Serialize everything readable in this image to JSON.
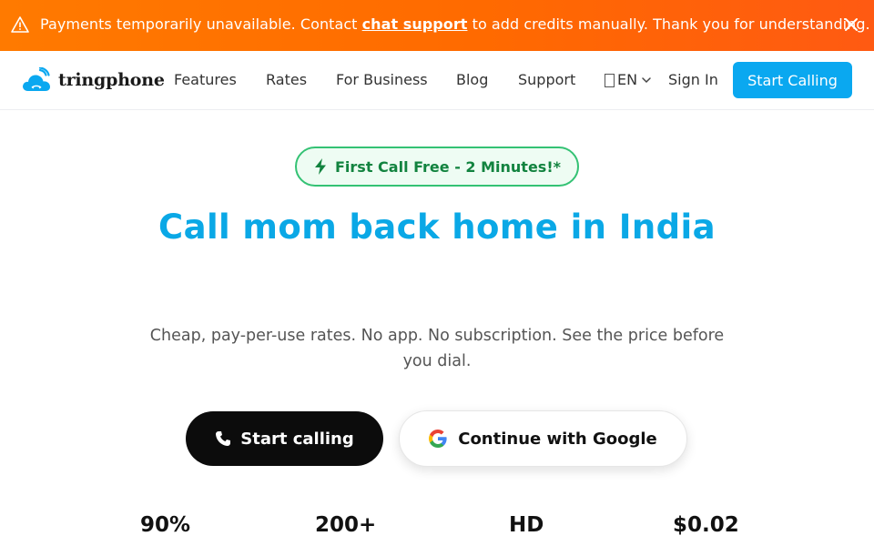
{
  "banner": {
    "icon": "warning-icon",
    "text_before": "Payments temporarily unavailable. Contact ",
    "link_label": "chat support",
    "text_after": " to add credits manually. Thank you for understanding.",
    "close_icon": "close-icon",
    "background": "#ff7a00"
  },
  "nav": {
    "brand": "tringphone",
    "logo_icon": "cloud-phone-icon",
    "links": [
      "Features",
      "Rates",
      "For Business",
      "Blog",
      "Support"
    ],
    "language": "EN",
    "language_icon": "globe-icon",
    "sign_in": "Sign In",
    "cta": "Start Calling",
    "cta_color": "#0aa8f0"
  },
  "hero": {
    "badge": "First Call Free - 2 Minutes!*",
    "badge_icon": "lightning-icon",
    "badge_color": "#12833f",
    "title": "Call mom back home in India",
    "title_color": "#0aa8e6",
    "subtitle": "Cheap, pay-per-use rates. No app. No subscription. See the price before you dial.",
    "primary_cta": "Start calling",
    "primary_cta_icon": "phone-icon",
    "secondary_cta": "Continue with Google",
    "secondary_cta_icon": "google-icon"
  },
  "stats": [
    "90%",
    "200+",
    "HD",
    "$0.02"
  ]
}
